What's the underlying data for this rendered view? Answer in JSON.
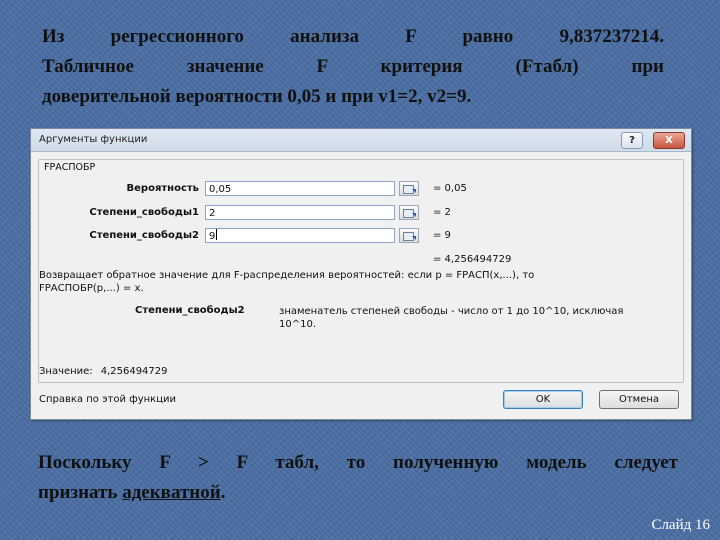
{
  "slide": {
    "top_lines": [
      "Из регрессионного анализа F равно 9,837237214.",
      "Табличное значение F критерия (Fтабл) при",
      "доверительной вероятности 0,05 и при v1=2, v2=9."
    ],
    "bottom_line1": "Поскольку F > F табл, то полученную модель следует",
    "bottom_line2_prefix": "признать ",
    "bottom_line2_underlined": "адекватной",
    "bottom_line2_suffix": ".",
    "slide_number": "Слайд 16"
  },
  "dialog": {
    "title": "Аргументы функции",
    "help_btn": "?",
    "close_btn": "X",
    "function_name": "FРАСПОБР",
    "args": [
      {
        "label": "Вероятность",
        "value": "0,05",
        "result": "=  0,05"
      },
      {
        "label": "Степени_свободы1",
        "value": "2",
        "result": "=  2"
      },
      {
        "label": "Степени_свободы2",
        "value": "9",
        "result": "=  9"
      }
    ],
    "total_result": "=  4,256494729",
    "description_line1": "Возвращает обратное значение для F-распределения вероятностей: если p = FРАСП(x,...), то",
    "description_line2": "FРАСПОБР(p,...) = x.",
    "param_name": "Степени_свободы2",
    "param_desc_line1": "знаменатель степеней свободы - число от 1 до 10^10, исключая",
    "param_desc_line2": "10^10.",
    "value_label": "Значение:",
    "value": "4,256494729",
    "help_link": "Справка по этой функции",
    "ok_label": "OK",
    "cancel_label": "Отмена"
  }
}
